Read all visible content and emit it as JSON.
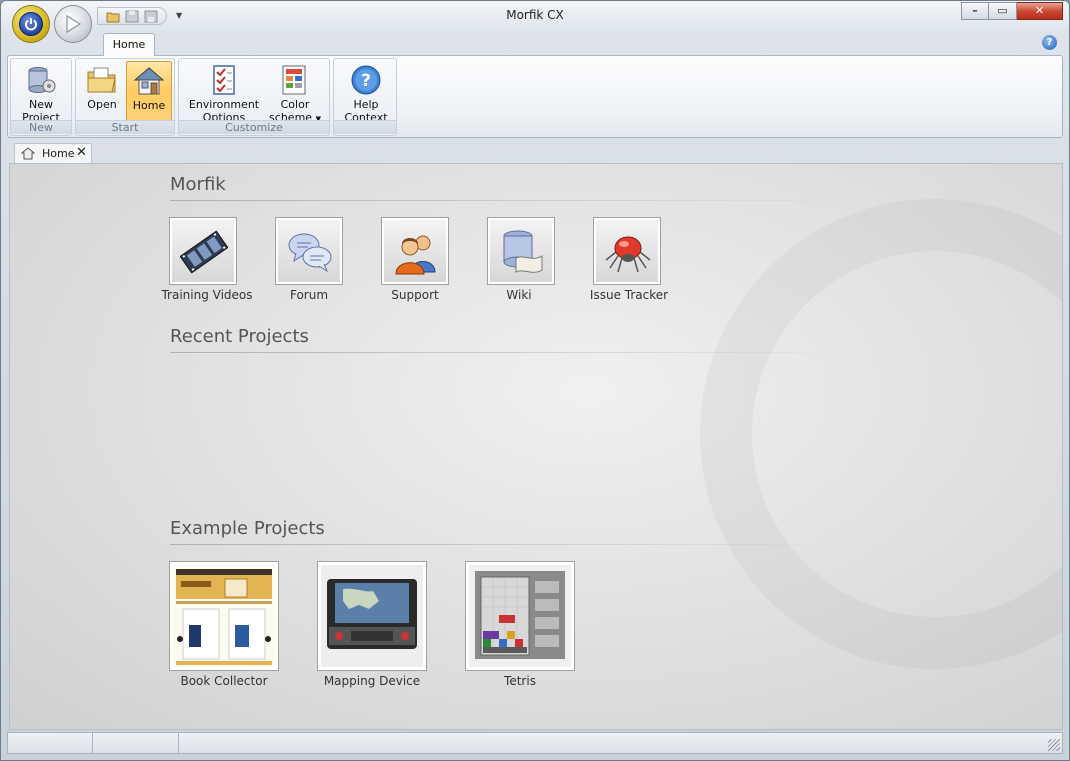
{
  "window": {
    "title": "Morfik CX"
  },
  "ribbon": {
    "tabs": [
      {
        "label": "Home"
      }
    ],
    "groups": {
      "new": {
        "label": "New",
        "buttons": [
          {
            "label_line1": "New",
            "label_line2": "Project"
          }
        ]
      },
      "start": {
        "label": "Start",
        "buttons": [
          {
            "label": "Open"
          },
          {
            "label": "Home"
          }
        ]
      },
      "customize": {
        "label": "Customize",
        "buttons": [
          {
            "label_line1": "Environment",
            "label_line2": "Options"
          },
          {
            "label_line1": "Color",
            "label_line2": "scheme"
          }
        ]
      },
      "help": {
        "buttons": [
          {
            "label_line1": "Help",
            "label_line2": "Context"
          }
        ]
      }
    }
  },
  "doc_tab": {
    "label": "Home"
  },
  "home": {
    "morfik_section": {
      "title": "Morfik",
      "links": [
        {
          "label": "Training Videos",
          "icon": "film-icon"
        },
        {
          "label": "Forum",
          "icon": "chat-bubbles-icon"
        },
        {
          "label": "Support",
          "icon": "people-icon"
        },
        {
          "label": "Wiki",
          "icon": "database-scroll-icon"
        },
        {
          "label": "Issue Tracker",
          "icon": "bug-icon"
        }
      ]
    },
    "recent_section": {
      "title": "Recent Projects"
    },
    "examples_section": {
      "title": "Example Projects",
      "projects": [
        {
          "label": "Book Collector"
        },
        {
          "label": "Mapping Device"
        },
        {
          "label": "Tetris"
        }
      ]
    }
  },
  "colors": {
    "accent_active": "#ffcc5e",
    "title_blue": "#1d3fa0"
  }
}
